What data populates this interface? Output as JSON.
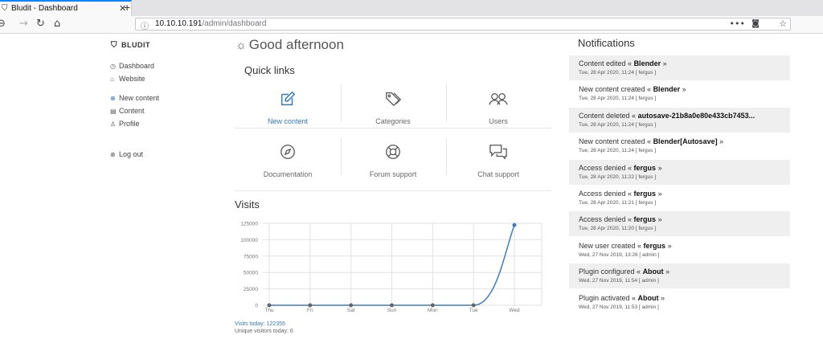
{
  "browser": {
    "tab_title": "Bludit - Dashboard",
    "url_host": "10.10.10.191",
    "url_path": "/admin/dashboard"
  },
  "sidebar": {
    "brand": "BLUDIT",
    "items": [
      {
        "label": "Dashboard",
        "icon": "dashboard-icon"
      },
      {
        "label": "Website",
        "icon": "home-icon"
      },
      {
        "label": "New content",
        "icon": "plus-circle-icon"
      },
      {
        "label": "Content",
        "icon": "archive-icon"
      },
      {
        "label": "Profile",
        "icon": "person-icon"
      },
      {
        "label": "Log out",
        "icon": "logout-icon"
      }
    ]
  },
  "greeting": "Good afternoon",
  "quick_links": {
    "title": "Quick links",
    "items": [
      {
        "label": "New content",
        "icon": "pencil-square-icon"
      },
      {
        "label": "Categories",
        "icon": "tags-icon"
      },
      {
        "label": "Users",
        "icon": "people-icon"
      },
      {
        "label": "Documentation",
        "icon": "compass-icon"
      },
      {
        "label": "Forum support",
        "icon": "lifebuoy-icon"
      },
      {
        "label": "Chat support",
        "icon": "chat-icon"
      }
    ]
  },
  "visits": {
    "title": "Visits",
    "visits_today": "Visits today: 122355",
    "unique_visitors": "Unique visitors today: 6"
  },
  "chart_data": {
    "type": "line",
    "categories": [
      "Thu",
      "Fri",
      "Sat",
      "Sun",
      "Mon",
      "Tue",
      "Wed"
    ],
    "series": [
      {
        "values": [
          0,
          0,
          0,
          0,
          0,
          0,
          122355
        ]
      }
    ],
    "ylim": [
      0,
      125000
    ],
    "yticks": [
      "0",
      "25000",
      "50000",
      "75000",
      "100000",
      "125000"
    ],
    "grid": true,
    "line_color": "#3e7cc1"
  },
  "notifications": {
    "title": "Notifications",
    "items": [
      {
        "prefix": "Content edited « ",
        "bold": "Blender",
        "suffix": " »",
        "meta": "Tue, 28 Apr 2020, 11:24 [ fergus ]"
      },
      {
        "prefix": "New content created « ",
        "bold": "Blender",
        "suffix": " »",
        "meta": "Tue, 28 Apr 2020, 11:24 [ fergus ]"
      },
      {
        "prefix": "Content deleted « ",
        "bold": "autosave-21b8a0e80e433cb7453...",
        "suffix": "",
        "meta": "Tue, 28 Apr 2020, 11:24 [ fergus ]"
      },
      {
        "prefix": "New content created « ",
        "bold": "Blender[Autosave]",
        "suffix": " »",
        "meta": "Tue, 28 Apr 2020, 11:24 [ fergus ]"
      },
      {
        "prefix": "Access denied « ",
        "bold": "fergus",
        "suffix": " »",
        "meta": "Tue, 28 Apr 2020, 11:22 [ fergus ]"
      },
      {
        "prefix": "Access denied « ",
        "bold": "fergus",
        "suffix": " »",
        "meta": "Tue, 28 Apr 2020, 11:21 [ fergus ]"
      },
      {
        "prefix": "Access denied « ",
        "bold": "fergus",
        "suffix": " »",
        "meta": "Tue, 28 Apr 2020, 11:20 [ fergus ]"
      },
      {
        "prefix": "New user created « ",
        "bold": "fergus",
        "suffix": " »",
        "meta": "Wed, 27 Nov 2019, 13:26 [ admin ]"
      },
      {
        "prefix": "Plugin configured « ",
        "bold": "About",
        "suffix": " »",
        "meta": "Wed, 27 Nov 2019, 11:54 [ admin ]"
      },
      {
        "prefix": "Plugin activated « ",
        "bold": "About",
        "suffix": " »",
        "meta": "Wed, 27 Nov 2019, 11:53 [ admin ]"
      }
    ]
  }
}
